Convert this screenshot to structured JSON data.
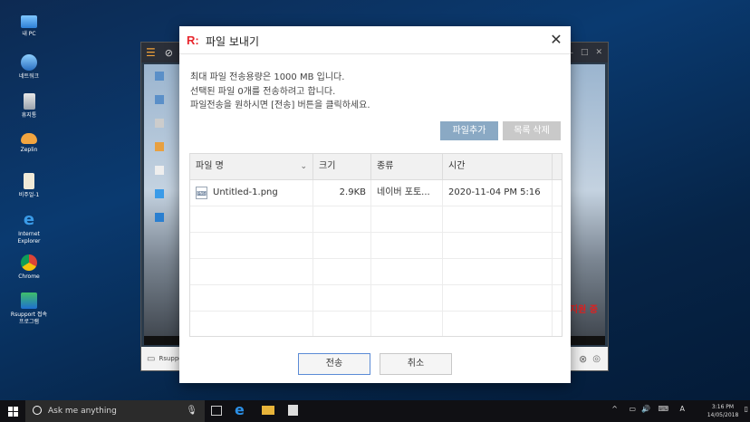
{
  "desktop": {
    "icons": [
      {
        "label": "내 PC",
        "icon": "computer-icon"
      },
      {
        "label": "네트워크",
        "icon": "network-icon"
      },
      {
        "label": "휴지통",
        "icon": "recycle-bin-icon"
      },
      {
        "label": "Zeplin",
        "icon": "zeplin-icon"
      },
      {
        "label": "비주얼-1",
        "icon": "document-icon"
      },
      {
        "label": "Internet Explorer",
        "icon": "ie-icon"
      },
      {
        "label": "Chrome",
        "icon": "chrome-icon"
      },
      {
        "label": "Rsupport 접속프로그램",
        "icon": "rsupport-icon"
      }
    ]
  },
  "remote_window": {
    "bottom_label": "Rsuppo",
    "overlay_text": "지원 중"
  },
  "dialog": {
    "title": "파일 보내기",
    "logo": "R:",
    "close_label": "✕",
    "info_lines": [
      "최대 파일 전송용량은 1000 MB 입니다.",
      "선택된 파일 0개를 전송하려고 합니다.",
      "파일전송을 원하시면 [전송] 버튼을 클릭하세요."
    ],
    "add_file_label": "파일추가",
    "delete_list_label": "목록 삭제",
    "columns": [
      "파일 명",
      "크기",
      "종류",
      "시간"
    ],
    "files": [
      {
        "name": "Untitled-1.png",
        "size": "2.9KB",
        "type": "네이버 포토...",
        "time": "2020-11-04 PM 5:16"
      }
    ],
    "send_label": "전송",
    "cancel_label": "취소"
  },
  "taskbar": {
    "search_placeholder": "Ask me anything",
    "time": "3:16 PM",
    "date": "14/05/2018"
  }
}
